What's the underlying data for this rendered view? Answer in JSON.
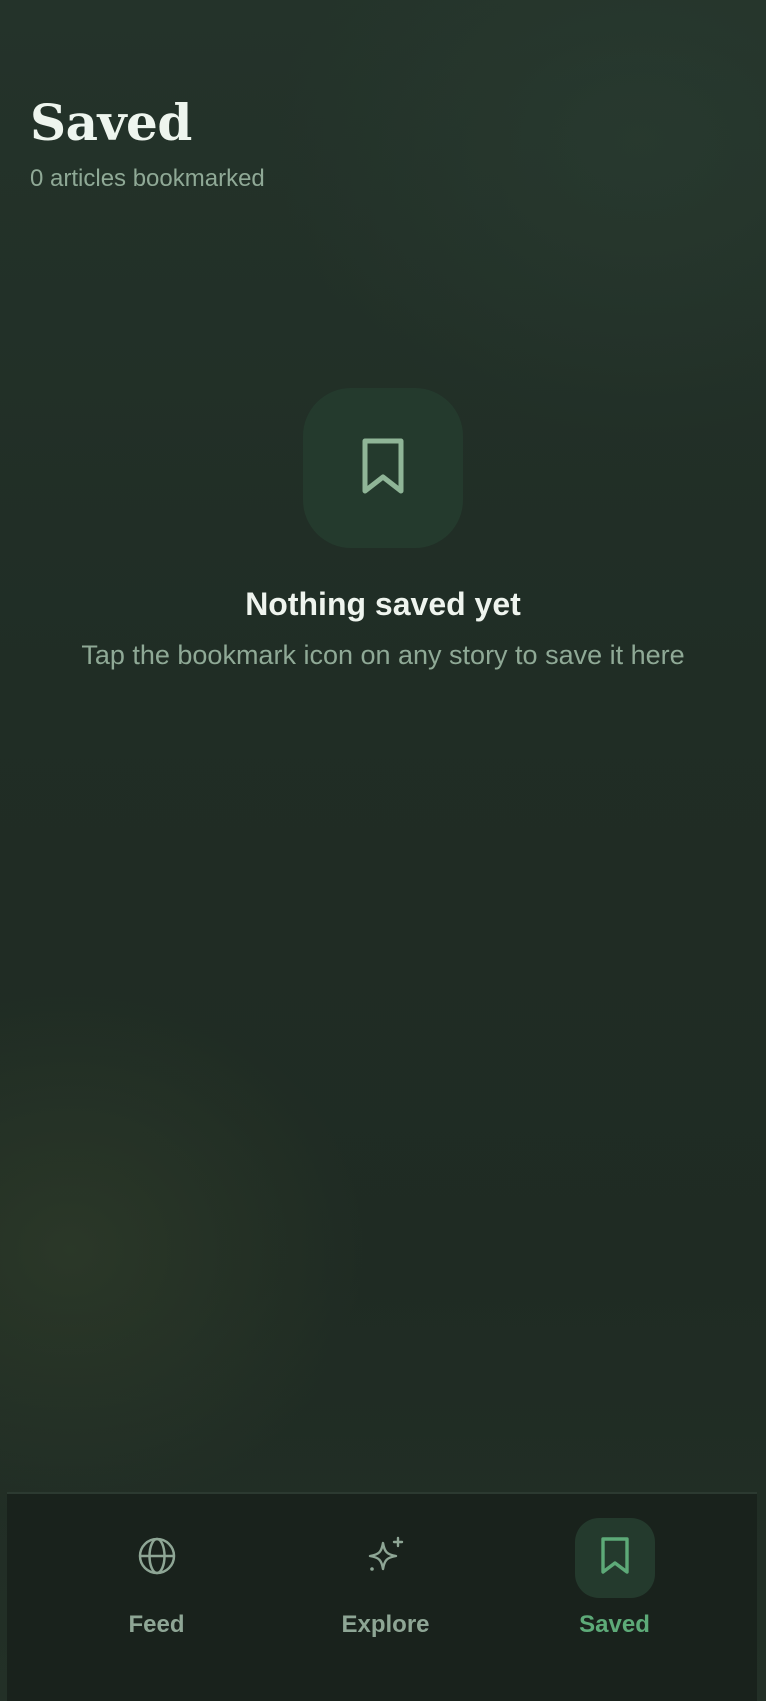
{
  "header": {
    "title": "Saved",
    "subtitle": "0 articles bookmarked"
  },
  "empty_state": {
    "icon": "bookmark-icon",
    "title": "Nothing saved yet",
    "message": "Tap the bookmark icon on any story to save it here"
  },
  "bottom_nav": {
    "items": [
      {
        "label": "Feed",
        "icon": "globe-icon",
        "active": false
      },
      {
        "label": "Explore",
        "icon": "sparkle-icon",
        "active": false
      },
      {
        "label": "Saved",
        "icon": "bookmark-icon",
        "active": true
      }
    ]
  },
  "colors": {
    "background": "#1f2c24",
    "accent": "#5daa78",
    "muted_text": "#8fa996",
    "icon_tile": "#243a2d",
    "nav_background": "#19221c"
  }
}
